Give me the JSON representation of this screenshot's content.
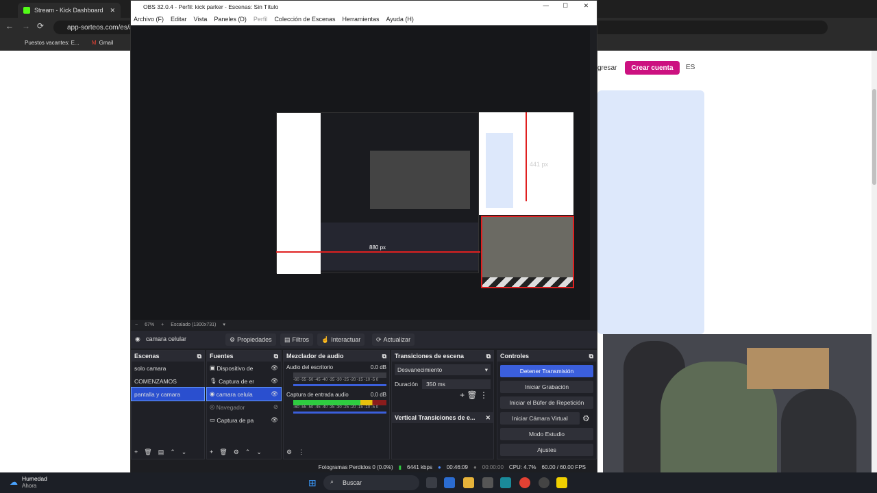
{
  "browser": {
    "tabs": [
      {
        "label": "Stream - Kick Dashboard"
      }
    ],
    "url": "app-sorteos.com/es/ap",
    "bookmarks": [
      "Puestos vacantes: E...",
      "Gmail"
    ]
  },
  "webpage": {
    "login_partial": "gresar",
    "crear_cuenta": "Crear cuenta",
    "lang": "ES"
  },
  "obs": {
    "title": "OBS 32.0.4 - Perfil: kick parker - Escenas: Sin Título",
    "menu": [
      "Archivo (F)",
      "Editar",
      "Vista",
      "Paneles (D)",
      "Perfil",
      "Colección de Escenas",
      "Herramientas",
      "Ayuda (H)"
    ],
    "zoom": "67%",
    "scale": "Escalado (1300x731)",
    "measure_1": "441 px",
    "measure_2": "880 px",
    "source_name": "camara celular",
    "source_btns": [
      "Propiedades",
      "Filtros",
      "Interactuar",
      "Actualizar"
    ],
    "docks": {
      "scenes": "Escenas",
      "sources": "Fuentes",
      "mixer": "Mezclador de audio",
      "transitions": "Transiciones de escena",
      "controls": "Controles"
    },
    "scenes": [
      "solo camara",
      "COMENZAMOS",
      "pantalla y camara"
    ],
    "sources": [
      "Dispositivo de",
      "Captura de er",
      "camara celula",
      "Navegador",
      "Captura de pa"
    ],
    "mixer": [
      {
        "name": "Audio del escritorio",
        "db": "0.0 dB"
      },
      {
        "name": "Captura de entrada audio",
        "db": "0.0 dB"
      }
    ],
    "mixer_scale": "-60 -55 -50 -45 -40 -35 -30 -25 -20 -15 -10 -5 0",
    "transition": "Desvanecimiento",
    "duration_label": "Duración",
    "duration": "350 ms",
    "vertical_transitions": "Vertical Transiciones de e...",
    "controls": [
      "Detener Transmisión",
      "Iniciar Grabación",
      "Iniciar el Búfer de Repetición",
      "Iniciar Cámara Virtual",
      "Modo Estudio",
      "Ajustes"
    ],
    "status": {
      "dropped": "Fotogramas Perdidos 0 (0.0%)",
      "kbps": "6441 kbps",
      "live_time": "00:46:09",
      "rec_time": "00:00:00",
      "cpu": "CPU: 4.7%",
      "fps": "60.00 / 60.00 FPS"
    }
  },
  "taskbar": {
    "weather": "Humedad",
    "weather_sub": "Ahora",
    "search": "Buscar"
  },
  "colors": {
    "obs_bg": "#1d1e22",
    "accent": "#3b5fdc",
    "crear": "#cc1180",
    "kick": "#53fc18"
  }
}
